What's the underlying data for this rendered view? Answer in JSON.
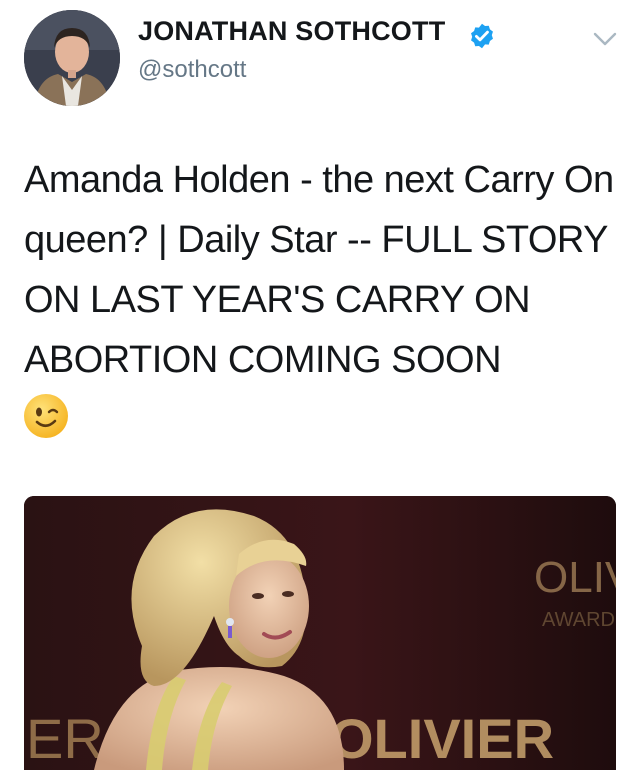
{
  "tweet": {
    "author": {
      "display_name": "JONATHAN SOTHCOTT",
      "handle": "@sothcott",
      "verified": true,
      "avatar_icon": "profile-photo"
    },
    "text": "Amanda Holden - the next Carry On queen? | Daily Star -- FULL STORY ON LAST YEAR'S CARRY ON ABORTION COMING SOON",
    "emoji": "winking-face",
    "menu_icon": "chevron-down-icon",
    "media": {
      "type": "photo",
      "backdrop_text_left": "ER",
      "backdrop_text_center": "OLIVIER",
      "backdrop_text_right": "OLIV",
      "backdrop_text_right_sub": "AWARD"
    }
  },
  "colors": {
    "text": "#14171a",
    "secondary": "#657786",
    "verified": "#1da1f2",
    "chevron": "#aab8c2"
  }
}
